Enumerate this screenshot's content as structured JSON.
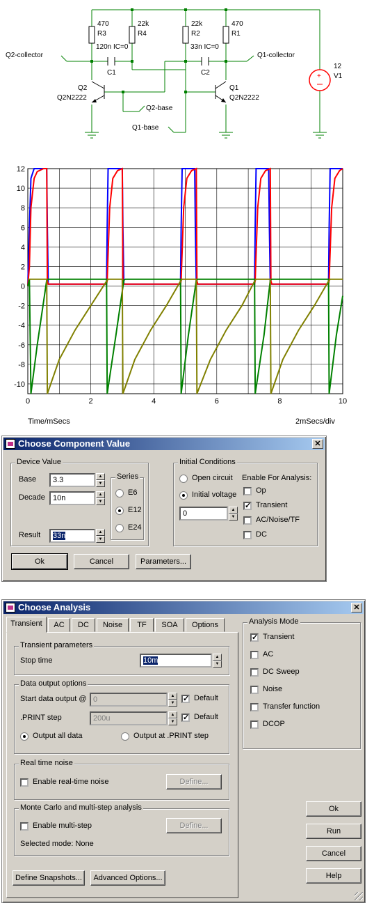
{
  "schematic": {
    "labels": {
      "r3_value": "470",
      "r3_name": "R3",
      "r4_value": "22k",
      "r4_name": "R4",
      "r2_value": "22k",
      "r2_name": "R2",
      "r1_value": "470",
      "r1_name": "R1",
      "c1_value": "120n IC=0",
      "c1_name": "C1",
      "c2_value": "33n IC=0",
      "c2_name": "C2",
      "q2_name": "Q2",
      "q2_model": "Q2N2222",
      "q1_name": "Q1",
      "q1_model": "Q2N2222",
      "v1_value": "12",
      "v1_name": "V1",
      "probe_q2_collector": "Q2-collector",
      "probe_q1_collector": "Q1-collector",
      "probe_q2_base": "Q2-base",
      "probe_q1_base": "Q1-base"
    }
  },
  "chart_data": {
    "type": "line",
    "xlabel": "Time/mSecs",
    "x_scale_note": "2mSecs/div",
    "xlim": [
      0,
      10
    ],
    "ylim": [
      -11,
      12
    ],
    "x_ticks": [
      0,
      2,
      4,
      6,
      8,
      10
    ],
    "y_ticks": [
      12,
      10,
      8,
      6,
      4,
      2,
      0,
      -2,
      -4,
      -6,
      -8,
      -10
    ],
    "grid": true,
    "series": [
      {
        "color": "#0000ff",
        "x": [
          0,
          0.05,
          0.1,
          0.2,
          0.6,
          0.62,
          0.65,
          0.7,
          2.45,
          2.5,
          2.52,
          2.55,
          3.0,
          3.02,
          3.05,
          3.1,
          4.8,
          4.85,
          4.87,
          4.9,
          5.3,
          5.32,
          5.35,
          5.4,
          7.15,
          7.2,
          7.22,
          7.25,
          7.65,
          7.67,
          7.7,
          7.75,
          9.5,
          9.55,
          9.57,
          9.6,
          10
        ],
        "values": [
          0,
          6,
          11,
          12,
          12,
          6,
          0.2,
          0.2,
          0.2,
          0.2,
          6,
          12,
          12,
          6,
          0.2,
          0.2,
          0.2,
          0.2,
          6,
          12,
          12,
          6,
          0.2,
          0.2,
          0.2,
          0.2,
          6,
          12,
          12,
          6,
          0.2,
          0.2,
          0.2,
          0.2,
          6,
          12,
          12
        ]
      },
      {
        "color": "#ff0000",
        "x": [
          0,
          0.05,
          0.1,
          0.2,
          0.3,
          0.5,
          0.6,
          0.62,
          0.65,
          2.5,
          2.52,
          2.6,
          2.7,
          2.85,
          3.0,
          3.02,
          3.05,
          4.85,
          4.87,
          4.95,
          5.05,
          5.2,
          5.35,
          5.37,
          5.4,
          7.2,
          7.22,
          7.3,
          7.4,
          7.55,
          7.7,
          7.72,
          7.75,
          9.55,
          9.57,
          9.65,
          9.75,
          9.9,
          10
        ],
        "values": [
          0,
          2,
          8,
          11,
          11.7,
          12,
          12,
          0.5,
          0.2,
          0.2,
          0.6,
          8,
          11,
          11.8,
          12,
          0.5,
          0.2,
          0.2,
          0.6,
          8,
          11,
          11.8,
          12,
          0.5,
          0.2,
          0.2,
          0.6,
          8,
          11,
          11.8,
          12,
          0.5,
          0.2,
          0.2,
          0.6,
          8,
          11,
          11.8,
          12
        ]
      },
      {
        "color": "#008000",
        "x": [
          0,
          0.05,
          0.1,
          0.3,
          0.6,
          0.65,
          2.5,
          2.52,
          2.8,
          3.05,
          3.1,
          4.85,
          4.87,
          5.1,
          5.35,
          5.4,
          7.2,
          7.22,
          7.5,
          7.7,
          7.75,
          9.55,
          9.57,
          9.8,
          10
        ],
        "values": [
          0,
          0.7,
          -11,
          -6,
          0.6,
          0.7,
          0.7,
          -11,
          -5,
          0.6,
          0.7,
          0.7,
          -11,
          -5,
          0.6,
          0.7,
          0.7,
          -11,
          -5,
          0.6,
          0.7,
          0.7,
          -11,
          -5,
          -1
        ]
      },
      {
        "color": "#808000",
        "x": [
          0,
          0.6,
          0.62,
          1,
          1.5,
          2,
          2.5,
          2.55,
          3.0,
          3.02,
          3.4,
          3.9,
          4.4,
          4.85,
          4.9,
          5.35,
          5.37,
          5.8,
          6.3,
          6.8,
          7.2,
          7.25,
          7.7,
          7.72,
          8.1,
          8.6,
          9.1,
          9.55,
          9.6,
          10
        ],
        "values": [
          0.7,
          0.7,
          -11,
          -7.5,
          -4.5,
          -2,
          0.5,
          0.7,
          0.7,
          -11,
          -7.5,
          -4.5,
          -2,
          0.5,
          0.7,
          0.7,
          -11,
          -7.5,
          -4.5,
          -2,
          0.5,
          0.7,
          0.7,
          -11,
          -7.5,
          -4.5,
          -2,
          0.5,
          0.7,
          0.7
        ]
      }
    ]
  },
  "component_dialog": {
    "title": "Choose Component Value",
    "close_label": "✕",
    "device_value_group": "Device Value",
    "base_label": "Base",
    "base_value": "3.3",
    "decade_label": "Decade",
    "decade_value": "10n",
    "result_label": "Result",
    "result_value": "33n",
    "series_group": "Series",
    "series_options": [
      "E6",
      "E12",
      "E24"
    ],
    "series_selected": "E12",
    "initial_conditions_group": "Initial Conditions",
    "open_circuit_label": "Open circuit",
    "initial_voltage_label": "Initial voltage",
    "initial_voltage_value": "0",
    "enable_for_analysis_label": "Enable For Analysis:",
    "analysis_checks": [
      {
        "label": "Op",
        "checked": false
      },
      {
        "label": "Transient",
        "checked": true
      },
      {
        "label": "AC/Noise/TF",
        "checked": false
      },
      {
        "label": "DC",
        "checked": false
      }
    ],
    "ok_label": "Ok",
    "cancel_label": "Cancel",
    "parameters_label": "Parameters..."
  },
  "analysis_dialog": {
    "title": "Choose Analysis",
    "close_label": "✕",
    "tabs": [
      "Transient",
      "AC",
      "DC",
      "Noise",
      "TF",
      "SOA",
      "Options"
    ],
    "active_tab": "Transient",
    "transient_params_group": "Transient parameters",
    "stop_time_label": "Stop time",
    "stop_time_value": "10m",
    "data_output_group": "Data output options",
    "start_output_label": "Start data output @",
    "start_output_value": "0",
    "print_step_label": ".PRINT step",
    "print_step_value": "200u",
    "default_label": "Default",
    "output_all_label": "Output all data",
    "output_print_label": "Output at .PRINT step",
    "real_time_noise_group": "Real time noise",
    "enable_rt_noise_label": "Enable real-time noise",
    "define_label": "Define...",
    "monte_carlo_group": "Monte Carlo and multi-step analysis",
    "enable_multistep_label": "Enable multi-step",
    "selected_mode_label": "Selected mode: None",
    "define_snapshots_label": "Define Snapshots...",
    "advanced_options_label": "Advanced Options...",
    "analysis_mode_group": "Analysis Mode",
    "analysis_modes": [
      {
        "label": "Transient",
        "checked": true
      },
      {
        "label": "AC",
        "checked": false
      },
      {
        "label": "DC Sweep",
        "checked": false
      },
      {
        "label": "Noise",
        "checked": false
      },
      {
        "label": "Transfer function",
        "checked": false
      },
      {
        "label": "DCOP",
        "checked": false
      }
    ],
    "ok_label": "Ok",
    "run_label": "Run",
    "cancel_label": "Cancel",
    "help_label": "Help"
  }
}
